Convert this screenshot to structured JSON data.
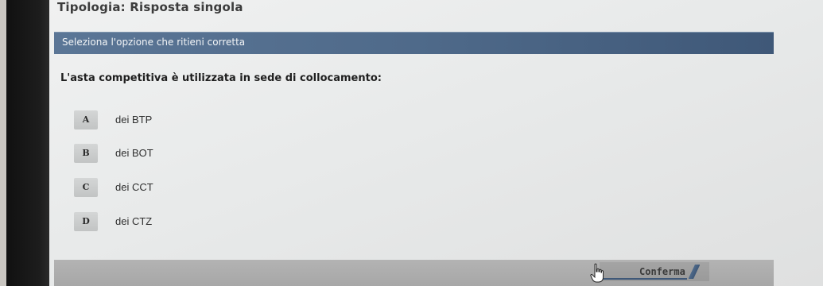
{
  "header": {
    "title": "Tipologia: Risposta singola"
  },
  "instruction": {
    "text": "Seleziona l'opzione che ritieni corretta"
  },
  "question": {
    "text": "L'asta competitiva è utilizzata in sede di collocamento:"
  },
  "options": [
    {
      "letter": "A",
      "text": "dei BTP"
    },
    {
      "letter": "B",
      "text": "dei BOT"
    },
    {
      "letter": "C",
      "text": "dei CCT"
    },
    {
      "letter": "D",
      "text": "dei CTZ"
    }
  ],
  "footer": {
    "confirm_label": "Conferma"
  },
  "cursor": {
    "icon": "hand-pointer-icon"
  },
  "colors": {
    "accent_bar": "#4f6a8a",
    "footer": "#adadad"
  }
}
